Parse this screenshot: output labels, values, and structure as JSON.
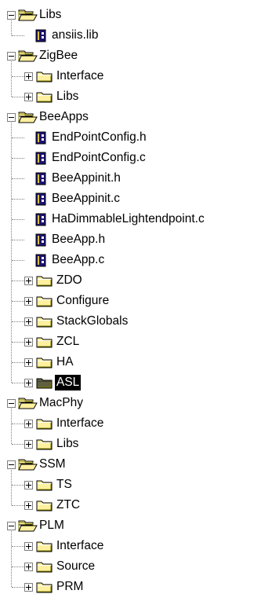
{
  "tree": [
    {
      "label": "Libs",
      "type": "folder",
      "expanded": true,
      "children": [
        {
          "label": "ansiis.lib",
          "type": "file"
        }
      ]
    },
    {
      "label": "ZigBee",
      "type": "folder",
      "expanded": true,
      "children": [
        {
          "label": "Interface",
          "type": "folder",
          "expanded": false
        },
        {
          "label": "Libs",
          "type": "folder",
          "expanded": false
        }
      ]
    },
    {
      "label": "BeeApps",
      "type": "folder",
      "expanded": true,
      "children": [
        {
          "label": "EndPointConfig.h",
          "type": "file"
        },
        {
          "label": "EndPointConfig.c",
          "type": "file"
        },
        {
          "label": "BeeAppinit.h",
          "type": "file"
        },
        {
          "label": "BeeAppinit.c",
          "type": "file"
        },
        {
          "label": "HaDimmableLightendpoint.c",
          "type": "file"
        },
        {
          "label": "BeeApp.h",
          "type": "file"
        },
        {
          "label": "BeeApp.c",
          "type": "file"
        },
        {
          "label": "ZDO",
          "type": "folder",
          "expanded": false
        },
        {
          "label": "Configure",
          "type": "folder",
          "expanded": false
        },
        {
          "label": "StackGlobals",
          "type": "folder",
          "expanded": false
        },
        {
          "label": "ZCL",
          "type": "folder",
          "expanded": false
        },
        {
          "label": "HA",
          "type": "folder",
          "expanded": false
        },
        {
          "label": "ASL",
          "type": "folder",
          "expanded": false,
          "selected": true
        }
      ]
    },
    {
      "label": "MacPhy",
      "type": "folder",
      "expanded": true,
      "children": [
        {
          "label": "Interface",
          "type": "folder",
          "expanded": false
        },
        {
          "label": "Libs",
          "type": "folder",
          "expanded": false
        }
      ]
    },
    {
      "label": "SSM",
      "type": "folder",
      "expanded": true,
      "children": [
        {
          "label": "TS",
          "type": "folder",
          "expanded": false
        },
        {
          "label": "ZTC",
          "type": "folder",
          "expanded": false
        }
      ]
    },
    {
      "label": "PLM",
      "type": "folder",
      "expanded": true,
      "children": [
        {
          "label": "Interface",
          "type": "folder",
          "expanded": false
        },
        {
          "label": "Source",
          "type": "folder",
          "expanded": false
        },
        {
          "label": "PRM",
          "type": "folder",
          "expanded": false
        }
      ]
    }
  ],
  "colors": {
    "folder_fill": "#fff0a0",
    "folder_dark": "#808000",
    "folder_selected": "#606040",
    "file_fill": "#1c1470",
    "file_accent": "#d8c040",
    "tree_lines": "#7f7f7f",
    "selection_bg": "#000000",
    "selection_fg": "#ffffff"
  },
  "icons": {
    "folder_closed": "folder-icon",
    "folder_open": "folder-open-icon",
    "file": "source-file-icon",
    "expander_expanded": "collapse-icon",
    "expander_collapsed": "expand-icon"
  }
}
